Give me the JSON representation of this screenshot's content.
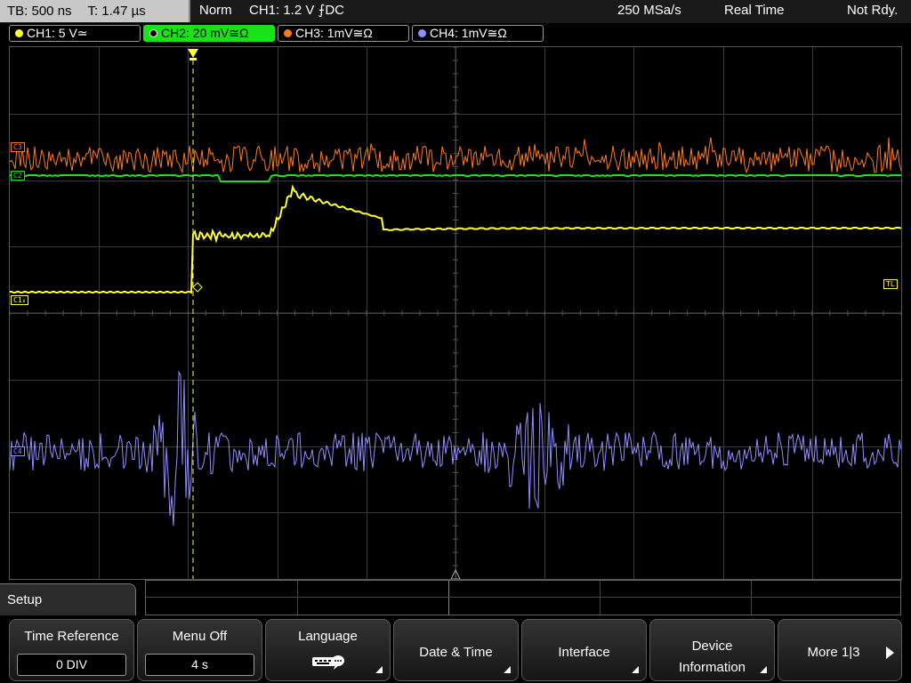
{
  "status": {
    "timebase": "TB: 500 ns",
    "trigger_time": "T: 1.47 µs",
    "mode": "Norm",
    "trigger": "CH1: 1.2 V ⨍DC",
    "sample_rate": "250 MSa/s",
    "acq_mode": "Real Time",
    "state": "Not Rdy."
  },
  "channels": [
    {
      "label": "CH1: 5 V≃",
      "color": "#ffff33",
      "active": false
    },
    {
      "label": "CH2: 20 mV≅Ω",
      "color": "#19e219",
      "active": true
    },
    {
      "label": "CH3: 1mV≅Ω",
      "color": "#ff7a1f",
      "active": false
    },
    {
      "label": "CH4: 1mV≅Ω",
      "color": "#8f8fff",
      "active": false
    }
  ],
  "markers": {
    "c3": "C3",
    "c2": "C2",
    "c1": "C1↓",
    "c4": "C4",
    "trigger_level": "TL"
  },
  "colors": {
    "ch1": "#ffff33",
    "ch2": "#19e219",
    "ch3": "#ff7a1f",
    "ch4": "#8f8fff",
    "grid": "#3a3a3a"
  },
  "menu": {
    "title": "Setup",
    "softkeys": [
      {
        "label": "Time Reference",
        "value": "0 DIV"
      },
      {
        "label": "Menu Off",
        "value": "4 s"
      },
      {
        "label": "Language",
        "icon": "keyboard-icon"
      },
      {
        "label": "Date & Time"
      },
      {
        "label": "Interface"
      },
      {
        "label_line1": "Device",
        "label_line2": "Information"
      },
      {
        "label": "More 1|3"
      }
    ]
  }
}
